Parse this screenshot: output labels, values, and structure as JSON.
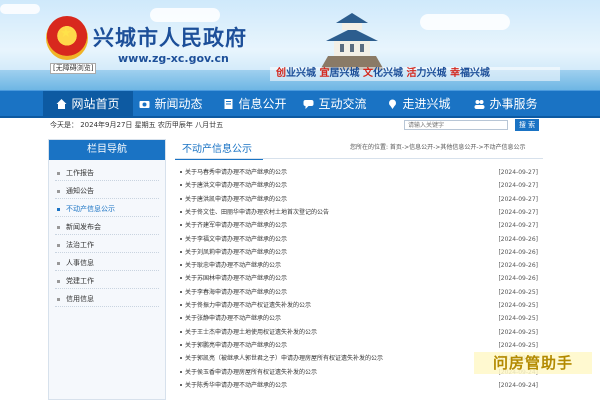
{
  "header": {
    "title": "兴城市人民政府",
    "url": "www.zg-xc.gov.cn",
    "barrier_free": "[无障碍浏览]",
    "slogan": [
      "创",
      "业兴城",
      "宜",
      "居兴城",
      "文",
      "化兴城",
      "活",
      "力兴城",
      "幸",
      "福兴城"
    ]
  },
  "nav": {
    "items": [
      {
        "label": "网站首页",
        "icon": "home-icon"
      },
      {
        "label": "新闻动态",
        "icon": "camera-icon"
      },
      {
        "label": "信息公开",
        "icon": "document-icon"
      },
      {
        "label": "互动交流",
        "icon": "chat-icon"
      },
      {
        "label": "走进兴城",
        "icon": "location-icon"
      },
      {
        "label": "办事服务",
        "icon": "people-icon"
      }
    ]
  },
  "datebar": {
    "text": "今天是：  2024年9月27日 星期五 农历甲辰年 八月廿五",
    "search_placeholder": "请输入关键字",
    "search_button": "搜 索"
  },
  "sidebar": {
    "title": "栏目导航",
    "items": [
      "工作报告",
      "通知公告",
      "不动产信息公示",
      "新闻发布会",
      "法治工作",
      "人事信息",
      "党建工作",
      "信用信息"
    ],
    "active": "不动产信息公示"
  },
  "main": {
    "tab": "不动产信息公示",
    "breadcrumb": "您所在的位置:  首页->信息公开->其他信息公开->不动产信息公示",
    "rows": [
      {
        "title": "关于马春秀申请办理不动产继承的公示",
        "date": "[2024-09-27]"
      },
      {
        "title": "关于唐洪文申请办理不动产继承的公示",
        "date": "[2024-09-27]"
      },
      {
        "title": "关于唐洪凯申请办理不动产继承的公示",
        "date": "[2024-09-27]"
      },
      {
        "title": "关于佟文佳、田丽华申请办理农村土地首次登记的公告",
        "date": "[2024-09-27]"
      },
      {
        "title": "关于齐建军申请办理不动产继承的公示",
        "date": "[2024-09-27]"
      },
      {
        "title": "关于李福文申请办理不动产继承的公示",
        "date": "[2024-09-26]"
      },
      {
        "title": "关于刘凤莉申请办理不动产继承的公示",
        "date": "[2024-09-26]"
      },
      {
        "title": "关于耿忠申请办理不动产继承的公示",
        "date": "[2024-09-26]"
      },
      {
        "title": "关于苏国林申请办理不动产继承的公示",
        "date": "[2024-09-26]"
      },
      {
        "title": "关于李春海申请办理不动产继承的公示",
        "date": "[2024-09-25]"
      },
      {
        "title": "关于佟振力申请办理不动产权证遗失补发的公示",
        "date": "[2024-09-25]"
      },
      {
        "title": "关于张静申请办理不动产继承的公示",
        "date": "[2024-09-25]"
      },
      {
        "title": "关于王士杰申请办理土地使用权证遗失补发的公示",
        "date": "[2024-09-25]"
      },
      {
        "title": "关于郭鹏亮申请办理不动产继承的公示",
        "date": "[2024-09-25]"
      },
      {
        "title": "关于郭凯亮（被继承人郭世君之子）申请办理房屋所有权证遗失补发的公示",
        "date": "[2024-09-24]"
      },
      {
        "title": "关于侯玉香申请办理房屋所有权证遗失补发的公示",
        "date": "[2024-09-24]"
      },
      {
        "title": "关于陈秀华申请办理不动产继承的公示",
        "date": "[2024-09-24]"
      }
    ]
  },
  "watermark": "问房管助手",
  "colors": {
    "nav": "#1a73c4",
    "nav_active": "#0d5aa2",
    "title": "#1d4f99",
    "slogan_accent": "#d4261c"
  }
}
